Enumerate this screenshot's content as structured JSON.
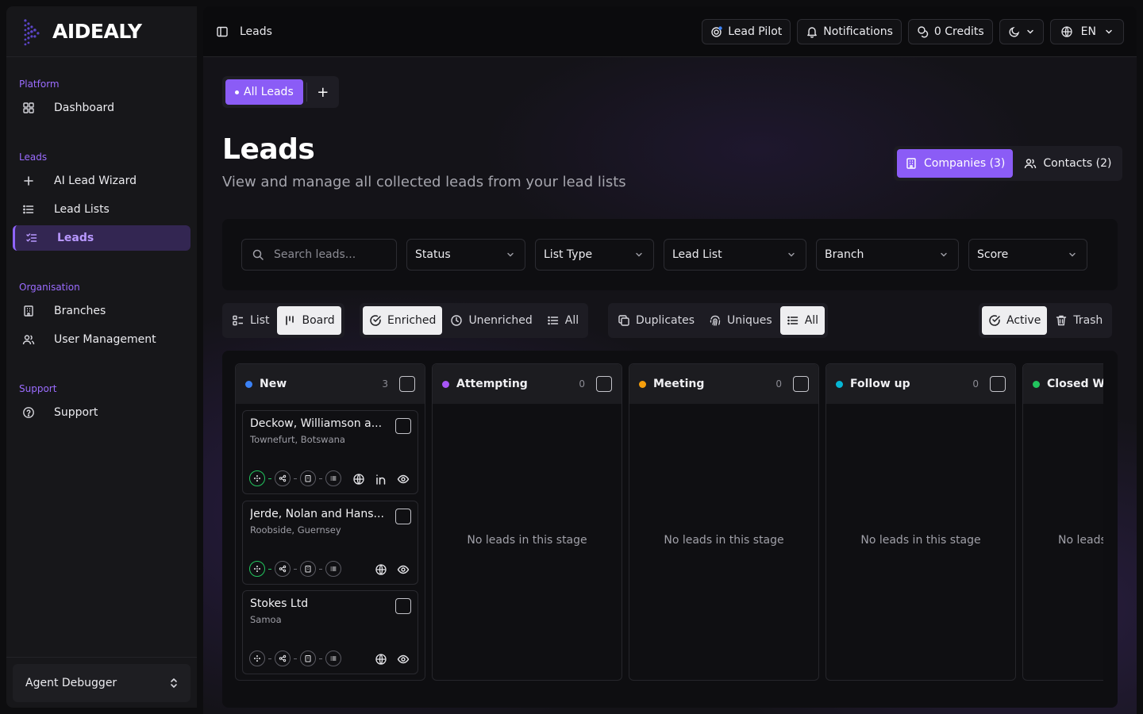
{
  "brand": {
    "name": "AIDEALY"
  },
  "sidebar": {
    "groups": [
      {
        "label": "Platform",
        "items": [
          {
            "label": "Dashboard",
            "icon": "grid-icon"
          }
        ]
      },
      {
        "label": "Leads",
        "items": [
          {
            "label": "AI Lead Wizard",
            "icon": "plus-icon"
          },
          {
            "label": "Lead Lists",
            "icon": "list-icon"
          },
          {
            "label": "Leads",
            "icon": "list-check-icon",
            "active": true
          }
        ]
      },
      {
        "label": "Organisation",
        "items": [
          {
            "label": "Branches",
            "icon": "building-icon"
          },
          {
            "label": "User Management",
            "icon": "users-icon"
          }
        ]
      },
      {
        "label": "Support",
        "items": [
          {
            "label": "Support",
            "icon": "help-circle-icon"
          }
        ]
      }
    ],
    "footer": {
      "label": "Agent Debugger"
    }
  },
  "topbar": {
    "breadcrumb": "Leads",
    "lead_pilot": "Lead Pilot",
    "notifications": "Notifications",
    "credits": "0 Credits",
    "language": "EN"
  },
  "tabs": {
    "active": "All Leads",
    "add": "+"
  },
  "page": {
    "title": "Leads",
    "subtitle": "View and manage all collected leads from your lead lists"
  },
  "entity_toggle": {
    "companies": "Companies (3)",
    "contacts": "Contacts (2)"
  },
  "filters": {
    "search_placeholder": "Search leads...",
    "status": "Status",
    "list_type": "List Type",
    "lead_list": "Lead List",
    "branch": "Branch",
    "score": "Score"
  },
  "view_toggle": {
    "list": "List",
    "board": "Board"
  },
  "enrich_toggle": {
    "enriched": "Enriched",
    "unenriched": "Unenriched",
    "all": "All"
  },
  "dup_toggle": {
    "duplicates": "Duplicates",
    "uniques": "Uniques",
    "all": "All"
  },
  "state_toggle": {
    "active": "Active",
    "trash": "Trash"
  },
  "board": {
    "empty_text": "No leads in this stage",
    "empty_text_cut": "No leads",
    "columns": [
      {
        "title": "New",
        "count": "3",
        "color": "#3b82f6"
      },
      {
        "title": "Attempting",
        "count": "0",
        "color": "#a855f7"
      },
      {
        "title": "Meeting",
        "count": "0",
        "color": "#f59e0b"
      },
      {
        "title": "Follow up",
        "count": "0",
        "color": "#06b6d4"
      },
      {
        "title": "Closed Wo",
        "count": "",
        "color": "#22c55e"
      }
    ],
    "cards": [
      {
        "name": "Deckow, Williamson a...",
        "location": "Townefurt, Botswana"
      },
      {
        "name": "Jerde, Nolan and Hans...",
        "location": "Roobside, Guernsey"
      },
      {
        "name": "Stokes Ltd",
        "location": "Samoa"
      }
    ]
  },
  "colors": {
    "accent": "#8b5cf6",
    "background": "#0d0d0f",
    "success": "#22c55e"
  }
}
